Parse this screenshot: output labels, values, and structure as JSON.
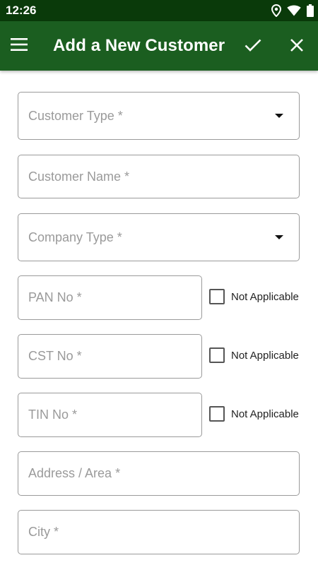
{
  "status_bar": {
    "time": "12:26",
    "icons": [
      "location-icon",
      "wifi-icon",
      "battery-icon"
    ]
  },
  "app_bar": {
    "title": "Add a New Customer",
    "icons": [
      "menu-icon",
      "check-icon",
      "close-icon"
    ],
    "background": "#1b5e20"
  },
  "form": {
    "customer_type": {
      "placeholder": "Customer Type *"
    },
    "customer_name": {
      "placeholder": "Customer Name *"
    },
    "company_type": {
      "placeholder": "Company Type *"
    },
    "pan_no": {
      "placeholder": "PAN No *",
      "not_applicable": "Not Applicable"
    },
    "cst_no": {
      "placeholder": "CST No *",
      "not_applicable": "Not Applicable"
    },
    "tin_no": {
      "placeholder": "TIN No *",
      "not_applicable": "Not Applicable"
    },
    "address": {
      "placeholder": "Address / Area *"
    },
    "city": {
      "placeholder": "City *"
    }
  }
}
